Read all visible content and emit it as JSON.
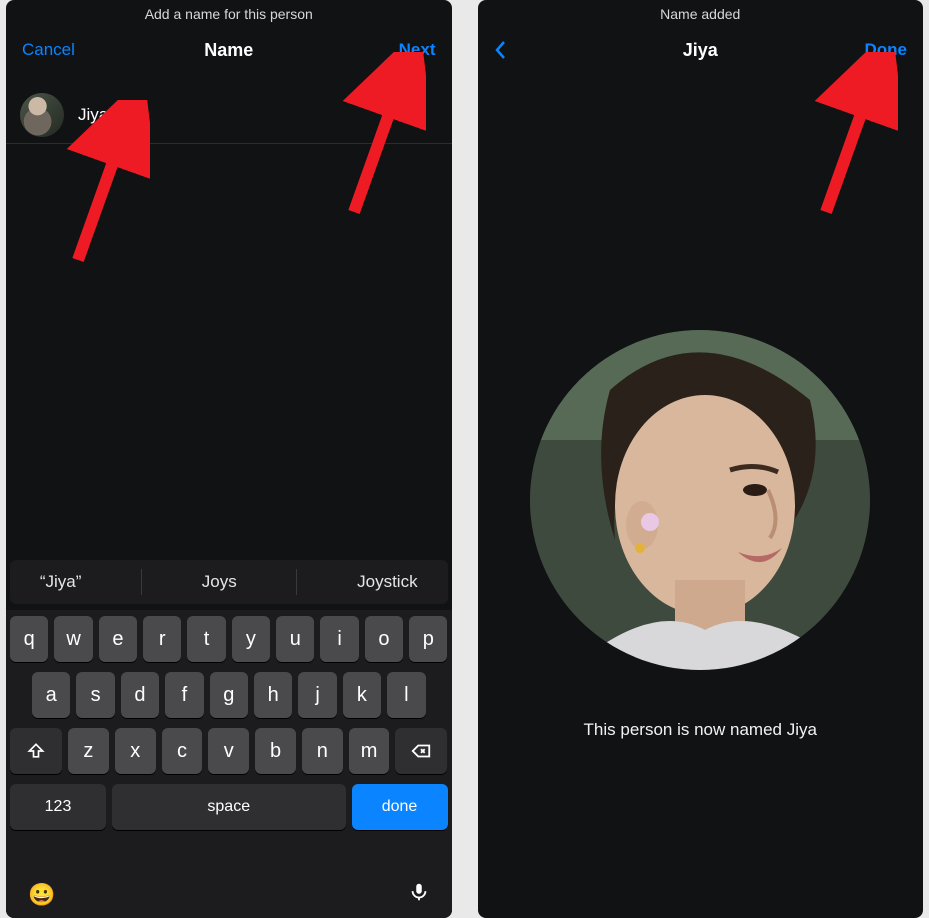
{
  "left": {
    "caption": "Add a name for this person",
    "nav": {
      "cancel": "Cancel",
      "title": "Name",
      "next": "Next"
    },
    "input_value": "Jiya",
    "suggestions": [
      "“Jiya”",
      "Joys",
      "Joystick"
    ],
    "keys": {
      "row1": [
        "q",
        "w",
        "e",
        "r",
        "t",
        "y",
        "u",
        "i",
        "o",
        "p"
      ],
      "row2": [
        "a",
        "s",
        "d",
        "f",
        "g",
        "h",
        "j",
        "k",
        "l"
      ],
      "row3": [
        "z",
        "x",
        "c",
        "v",
        "b",
        "n",
        "m"
      ],
      "num": "123",
      "space": "space",
      "done": "done"
    }
  },
  "right": {
    "caption": "Name added",
    "nav": {
      "title": "Jiya",
      "done": "Done"
    },
    "named_text": "This person is now named Jiya"
  }
}
